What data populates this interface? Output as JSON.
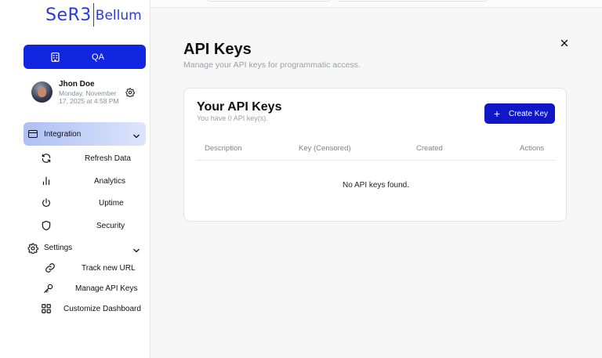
{
  "sidebar": {
    "logo": {
      "main": "SeR3",
      "rest": "Bellum"
    },
    "workspace": {
      "label": "QA",
      "icon": "building-icon"
    },
    "user": {
      "name": "Jhon Doe",
      "date": "Monday, November 17, 2025 at 4:58 PM",
      "settings_icon": "gear-icon"
    },
    "integration": {
      "label": "Integration",
      "icon": "window-icon",
      "items": [
        {
          "label": "Refresh Data",
          "icon": "refresh-icon"
        },
        {
          "label": "Analytics",
          "icon": "bar-chart-icon"
        },
        {
          "label": "Uptime",
          "icon": "power-icon"
        },
        {
          "label": "Security",
          "icon": "shield-icon"
        }
      ]
    },
    "settings": {
      "label": "Settings",
      "icon": "gear-icon",
      "items": [
        {
          "label": "Track new URL",
          "icon": "link-icon"
        },
        {
          "label": "Manage API Keys",
          "icon": "key-icon"
        },
        {
          "label": "Customize Dashboard",
          "icon": "grid-icon"
        }
      ]
    }
  },
  "main": {
    "title": "API Keys",
    "subtitle": "Manage your API keys for programmatic access.",
    "card": {
      "title": "Your API Keys",
      "count_text": "You have 0 API key(s).",
      "create_button": "Create Key",
      "columns": [
        "Description",
        "Key (Censored)",
        "Created",
        "Actions"
      ],
      "empty_text": "No API keys found."
    }
  },
  "colors": {
    "primary": "#1026e0",
    "button": "#1017c9",
    "brand": "#2b3ad6",
    "muted": "#9aa0ad"
  }
}
